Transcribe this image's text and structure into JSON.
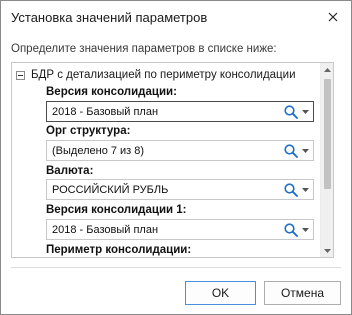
{
  "dialog": {
    "title": "Установка значений параметров",
    "close_icon": "close-icon"
  },
  "prompt": "Определите значения параметров в списке ниже:",
  "tree": {
    "root_label": "БДР с детализацией по периметру консолидации",
    "expander_state": "expanded",
    "params": [
      {
        "label": "Версия консолидации:",
        "value": "2018 - Базовый план",
        "focused": true
      },
      {
        "label": "Орг структура:",
        "value": "(Выделено 7 из 8)",
        "focused": false
      },
      {
        "label": "Валюта:",
        "value": "РОССИЙСКИЙ РУБЛЬ",
        "focused": false
      },
      {
        "label": "Версия консолидации 1:",
        "value": "2018 - Базовый план",
        "focused": false
      },
      {
        "label": "Периметр консолидации:"
      }
    ]
  },
  "buttons": {
    "ok": "OK",
    "cancel": "Отмена"
  },
  "colors": {
    "search_icon": "#1e6fc8",
    "ok_border": "#4a8fd9"
  }
}
